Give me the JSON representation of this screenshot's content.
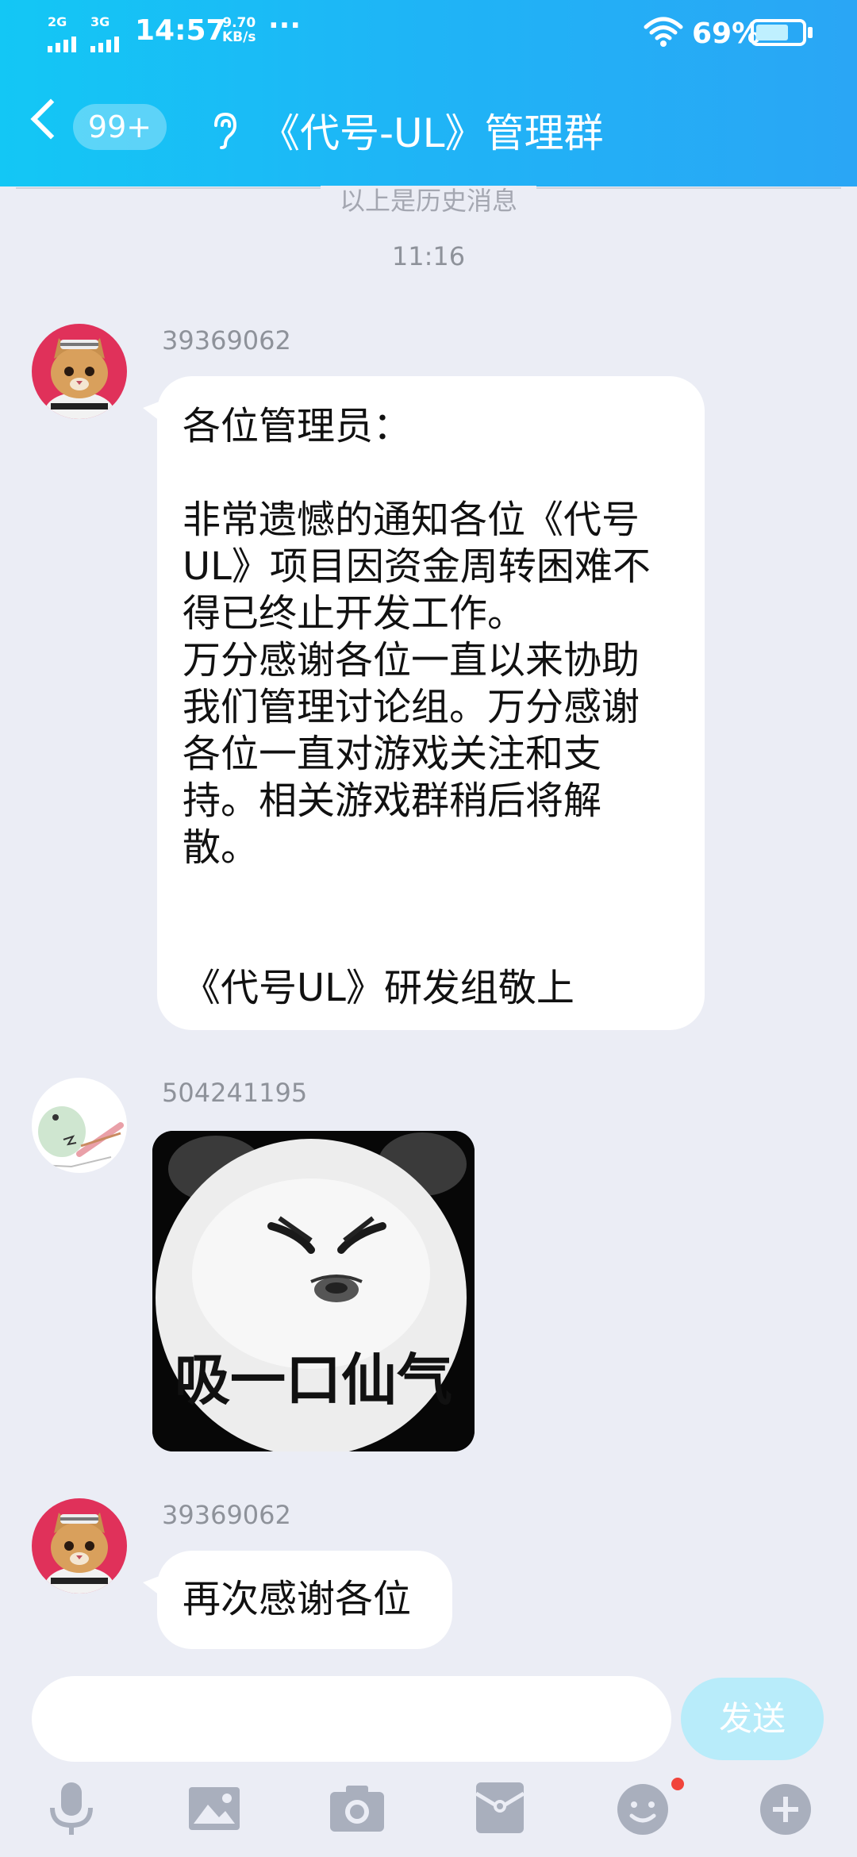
{
  "status_bar": {
    "net1": "2G",
    "net2": "3G",
    "time": "14:57",
    "speed_value": "9.70",
    "speed_unit": "KB/s",
    "more": "···",
    "battery": "69%",
    "battery_level": 0.69
  },
  "header": {
    "unread_badge": "99+",
    "title": "《代号-UL》管理群"
  },
  "chat": {
    "history_divider": "以上是历史消息",
    "time_label": "11:16",
    "messages": [
      {
        "sender": "39369062",
        "text": "各位管理员：\n\n非常遗憾的通知各位《代号\nUL》项目因资金周转困难不\n得已终止开发工作。\n万分感谢各位一直以来协助\n我们管理讨论组。万分感谢\n各位一直对游戏关注和支\n持。相关游戏群稍后将解\n散。\n\n\n《代号UL》研发组敬上"
      },
      {
        "sender": "504241195",
        "sticker_text": "吸一口仙气"
      },
      {
        "sender": "39369062",
        "text": "再次感谢各位"
      }
    ]
  },
  "input": {
    "placeholder": "",
    "send_label": "发送"
  },
  "toolbar": {
    "icons": [
      "microphone-icon",
      "image-icon",
      "camera-icon",
      "red-packet-icon",
      "emoji-icon",
      "plus-icon"
    ]
  },
  "colors": {
    "header_start": "#13c7f5",
    "header_end": "#2aa6f5",
    "background": "#ebedf5",
    "send_button": "#b8ecfa",
    "toolbar_icon": "#a9afbd",
    "notification_dot": "#f1443b"
  }
}
